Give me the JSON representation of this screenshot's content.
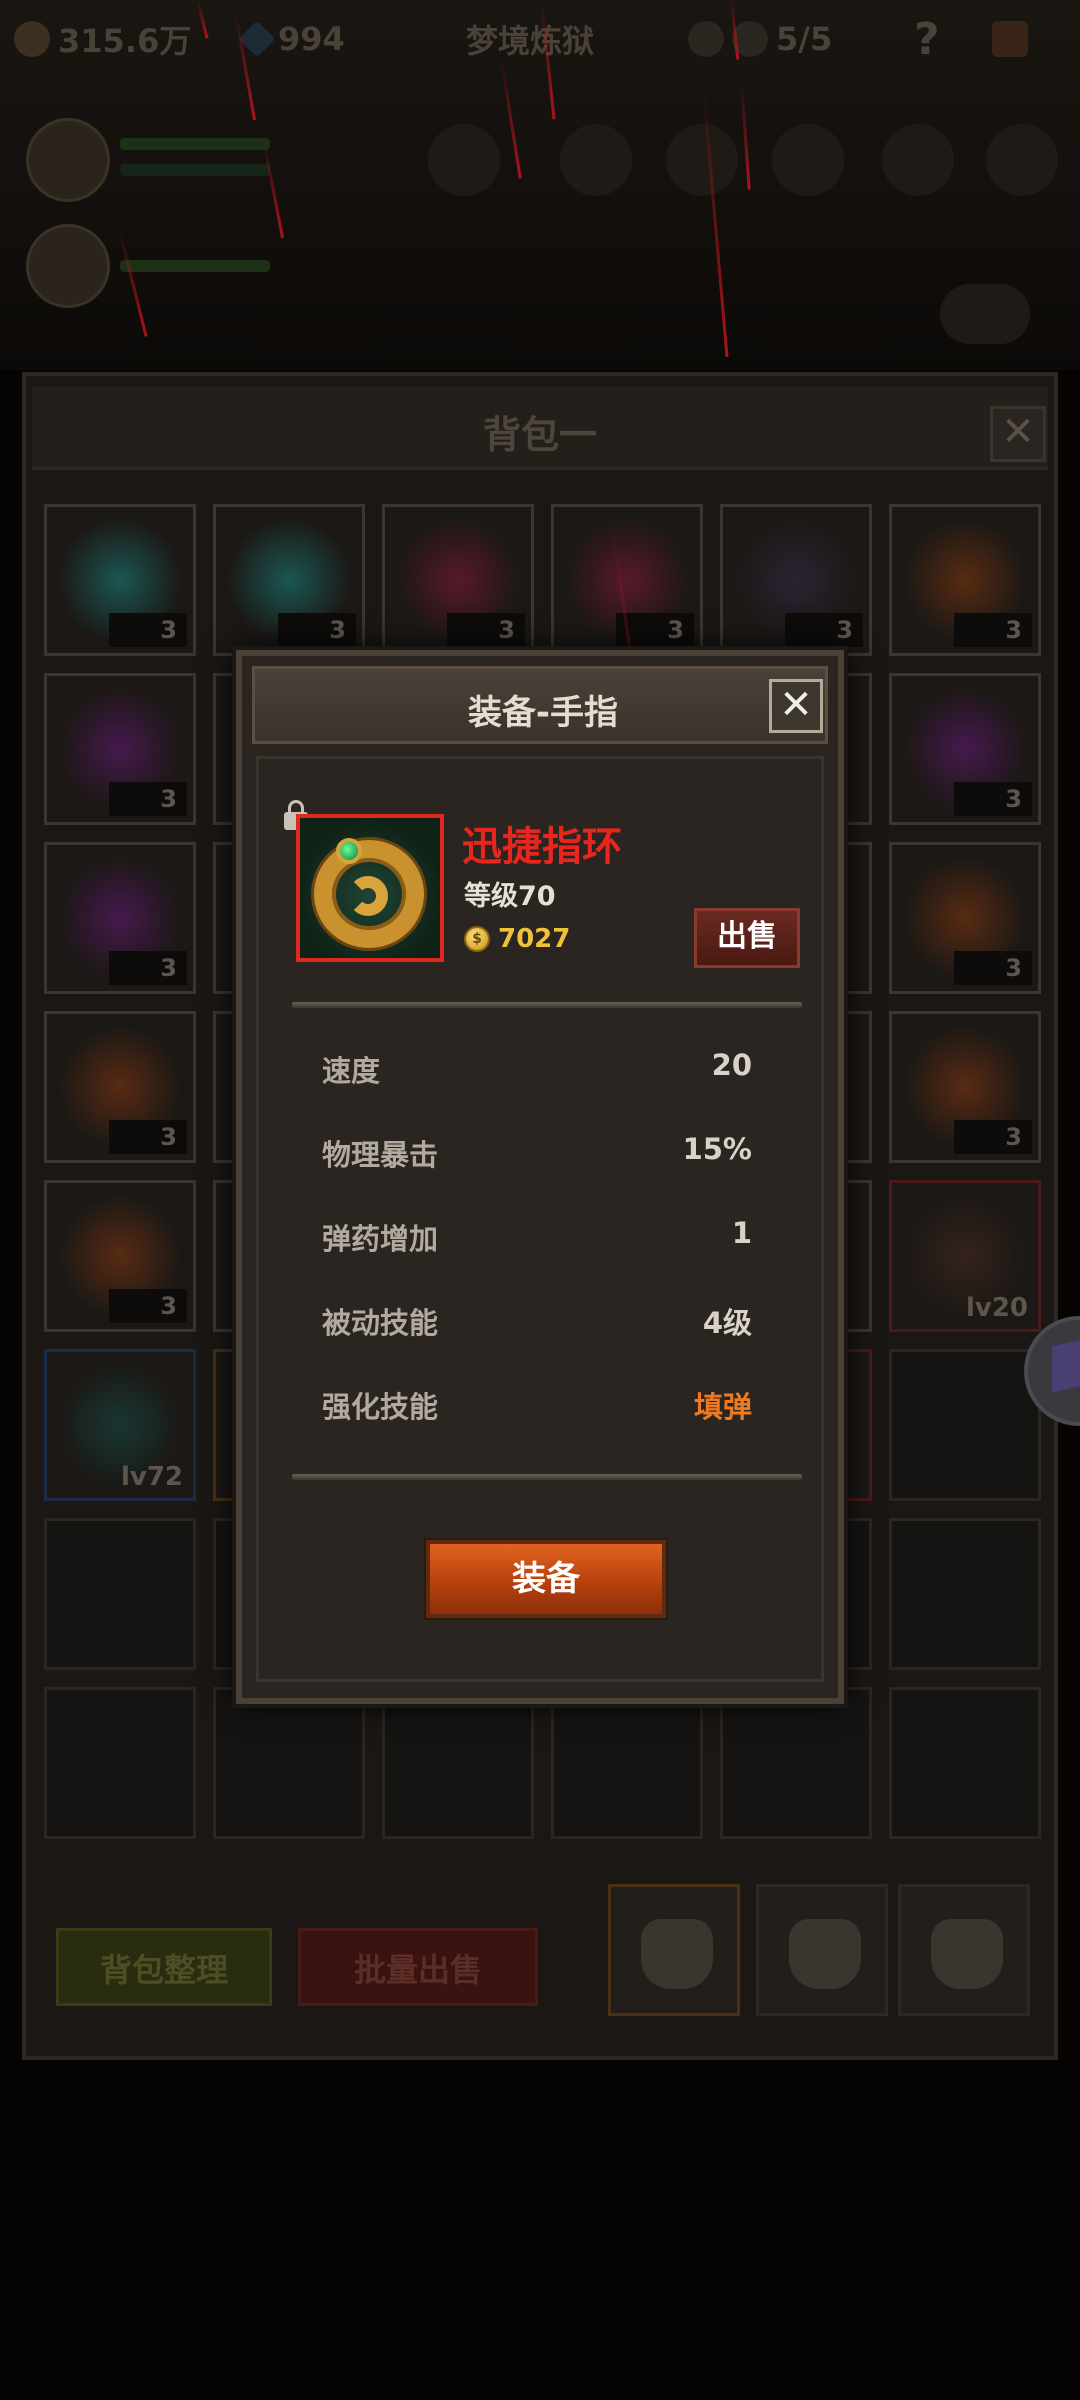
{
  "hud": {
    "gold": "315.6万",
    "gems": "994",
    "mode": "梦境炼狱",
    "keys": "5/5"
  },
  "bag": {
    "title": "背包一",
    "close_label": "✕",
    "slots": [
      {
        "count": "3",
        "glow": "#1b8a86"
      },
      {
        "count": "3",
        "glow": "#1b8a86"
      },
      {
        "count": "3",
        "glow": "#8a1a3a"
      },
      {
        "count": "3",
        "glow": "#8a1a3a"
      },
      {
        "count": "3",
        "glow": "#3a2a4a"
      },
      {
        "count": "3",
        "glow": "#8a3a10"
      },
      {
        "count": "3",
        "glow": "#6a1a7a"
      },
      {
        "count": "",
        "glow": ""
      },
      {
        "count": "",
        "glow": ""
      },
      {
        "count": "",
        "glow": ""
      },
      {
        "count": "",
        "glow": ""
      },
      {
        "count": "3",
        "glow": "#6a1a7a"
      },
      {
        "count": "3",
        "glow": "#6a1a7a"
      },
      {
        "count": "",
        "glow": ""
      },
      {
        "count": "",
        "glow": ""
      },
      {
        "count": "",
        "glow": ""
      },
      {
        "count": "",
        "glow": ""
      },
      {
        "count": "3",
        "glow": "#8a3a10"
      },
      {
        "count": "3",
        "glow": "#8a3a10"
      },
      {
        "count": "",
        "glow": ""
      },
      {
        "count": "",
        "glow": ""
      },
      {
        "count": "",
        "glow": ""
      },
      {
        "count": "",
        "glow": ""
      },
      {
        "count": "3",
        "glow": "#8a3a10"
      },
      {
        "count": "3",
        "glow": "#8a3a10"
      },
      {
        "count": "",
        "glow": ""
      },
      {
        "count": "",
        "glow": ""
      },
      {
        "count": "",
        "glow": ""
      },
      {
        "count": "",
        "glow": ""
      },
      {
        "count": "",
        "glow": "#3a1a10"
      }
    ],
    "slot_lv20": "lv20",
    "slot_lv72": "lv72",
    "sort_button": "背包整理",
    "bulk_sell_button": "批量出售"
  },
  "modal": {
    "title": "装备-手指",
    "close_label": "✕",
    "item_name": "迅捷指环",
    "item_level": "等级70",
    "coin_symbol": "$",
    "item_price": "7027",
    "sell_button": "出售",
    "stats": [
      {
        "key": "速度",
        "value": "20"
      },
      {
        "key": "物理暴击",
        "value": "15%"
      },
      {
        "key": "弹药增加",
        "value": "1"
      },
      {
        "key": "被动技能",
        "value": "4级"
      },
      {
        "key": "强化技能",
        "value": "填弹"
      }
    ],
    "equip_button": "装备"
  },
  "colors": {
    "item_name": "#e8261e",
    "price": "#f0c23a",
    "equip_button": "#d0561a",
    "enhance_skill": "#ee7a22"
  }
}
